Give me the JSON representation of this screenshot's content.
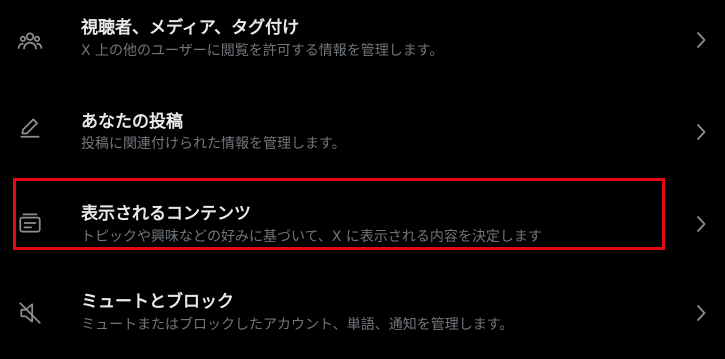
{
  "settings": {
    "items": [
      {
        "title": "視聴者、メディア、タグ付け",
        "subtitle": "X 上の他のユーザーに閲覧を許可する情報を管理します。",
        "icon": "people-icon"
      },
      {
        "title": "あなたの投稿",
        "subtitle": "投稿に関連付けられた情報を管理します。",
        "icon": "pencil-icon"
      },
      {
        "title": "表示されるコンテンツ",
        "subtitle": "トピックや興味などの好みに基づいて、X に表示される内容を決定します",
        "icon": "content-icon"
      },
      {
        "title": "ミュートとブロック",
        "subtitle": "ミュートまたはブロックしたアカウント、単語、通知を管理します。",
        "icon": "muted-speaker-icon"
      }
    ]
  },
  "colors": {
    "background": "#000000",
    "title": "#e7e9ea",
    "subtitle": "#71767b",
    "highlight": "#e50914"
  }
}
